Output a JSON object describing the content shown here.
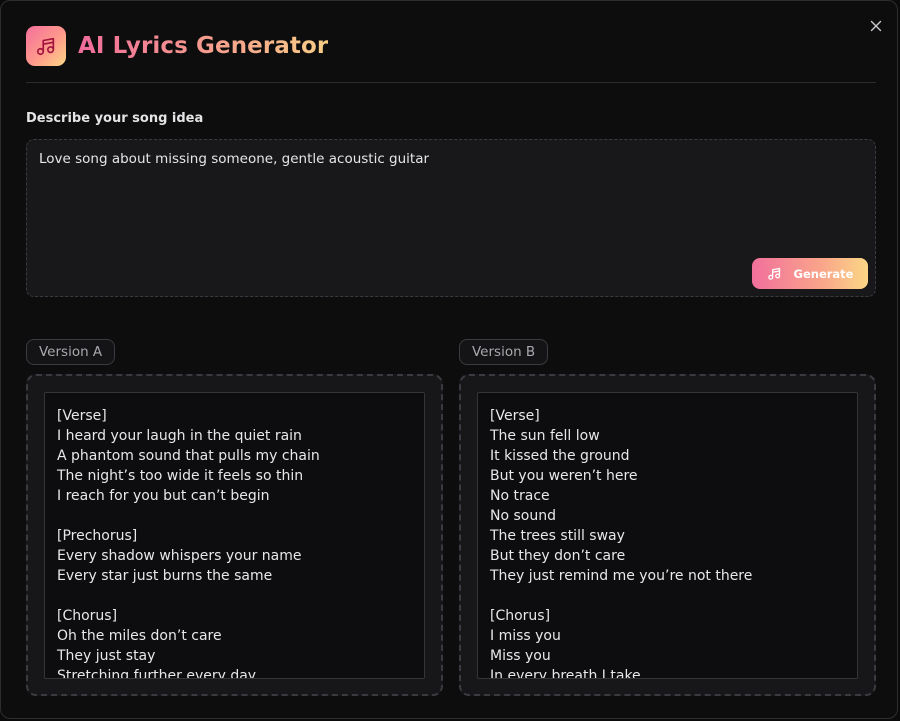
{
  "header": {
    "title": "AI Lyrics Generator",
    "logo_icon": "music-note-icon",
    "close_icon": "close-icon"
  },
  "prompt": {
    "label": "Describe your song idea",
    "value": "Love song about missing someone, gentle acoustic guitar",
    "generate_label": "Generate",
    "generate_icon": "music-note-icon"
  },
  "versions": [
    {
      "label": "Version A",
      "lines": [
        "[Verse]",
        "I heard your laugh in the quiet rain",
        "A phantom sound that pulls my chain",
        "The night’s too wide it feels so thin",
        "I reach for you but can’t begin",
        "",
        "[Prechorus]",
        "Every shadow whispers your name",
        "Every star just burns the same",
        "",
        "[Chorus]",
        "Oh the miles don’t care",
        "They just stay",
        "Stretching further every day"
      ]
    },
    {
      "label": "Version B",
      "lines": [
        "[Verse]",
        "The sun fell low",
        "It kissed the ground",
        "But you weren’t here",
        "No trace",
        "No sound",
        "The trees still sway",
        "But they don’t care",
        "They just remind me you’re not there",
        "",
        "[Chorus]",
        "I miss you",
        "Miss you",
        "In every breath I take"
      ]
    }
  ],
  "colors": {
    "accent_pink": "#f2709c",
    "accent_gold": "#fbd786",
    "background": "#0d0d0e"
  }
}
